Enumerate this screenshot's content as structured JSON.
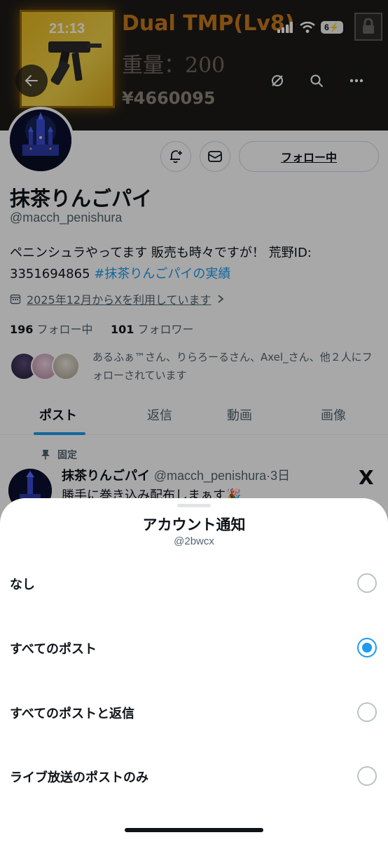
{
  "banner": {
    "weapon_title": "Dual TMP(Lv8)",
    "weapon_weight": "重量：200",
    "weapon_price": "¥4660095"
  },
  "status_bar": {
    "time": "21:13",
    "battery": "6"
  },
  "profile": {
    "follow_button": "フォロー中",
    "display_name": "抹茶りんごパイ",
    "handle": "@macch_penishura",
    "bio_text": "ペニンシュラやってます 販売も時々ですが！ 荒野ID: 3351694865",
    "bio_hashtag": "#抹茶りんごパイの実績",
    "joined": "2025年12月からXを利用しています",
    "following_count": "196",
    "following_label": "フォロー中",
    "followers_count": "101",
    "followers_label": "フォロワー",
    "followed_by": "あるふぁ™さん、りらろーるさん、Axel_さん、他２人にフォローされています"
  },
  "tabs": [
    {
      "label": "ポスト"
    },
    {
      "label": "返信"
    },
    {
      "label": "動画"
    },
    {
      "label": "画像"
    }
  ],
  "pinned_post": {
    "pinned_label": "固定",
    "author_name": "抹茶りんごパイ",
    "author_handle": "@macch_penishura",
    "time": "·3日",
    "text": "勝手に巻き込み配布しまぁす🎉"
  },
  "sheet": {
    "title": "アカウント通知",
    "subtitle": "@2bwcx",
    "options": [
      {
        "label": "なし",
        "selected": false
      },
      {
        "label": "すべてのポスト",
        "selected": true
      },
      {
        "label": "すべてのポストと返信",
        "selected": false
      },
      {
        "label": "ライブ放送のポストのみ",
        "selected": false
      }
    ]
  },
  "colors": {
    "accent": "#1d9bf0",
    "hashtag": "#1d9bf0",
    "weapon_title": "#c77a1c"
  }
}
